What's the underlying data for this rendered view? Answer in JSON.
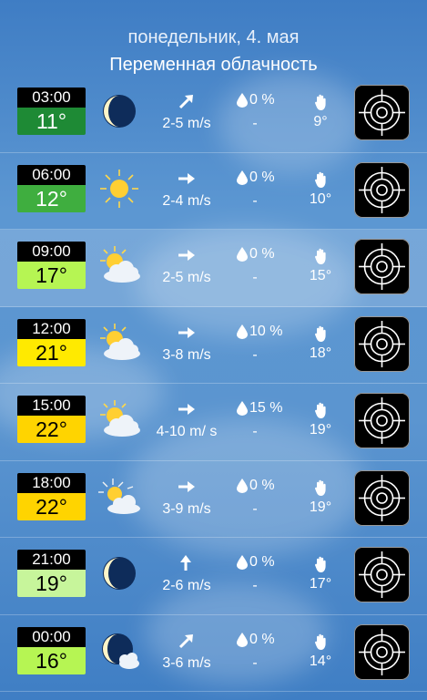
{
  "header": {
    "date": "понедельник, 4. мая",
    "condition": "Переменная облачность"
  },
  "colors": {
    "background": "#4f8ccb",
    "temp_green_dark": "#1e8a35",
    "temp_green": "#3fae3f",
    "temp_lime": "#b6f553",
    "temp_yellow": "#ffea00",
    "temp_yellow_orange": "#ffd400",
    "temp_light_green": "#c7f59b"
  },
  "rows": [
    {
      "time": "03:00",
      "temp": "11°",
      "temp_color": "#1e8a35",
      "temp_text": "#ffffff",
      "icon": "moon-icon",
      "wind_dir": "northeast-arrow-icon",
      "wind": "2-5 m/s",
      "precip_pct": "0 %",
      "precip_amt": "-",
      "uv": "9°",
      "highlight": false
    },
    {
      "time": "06:00",
      "temp": "12°",
      "temp_color": "#3fae3f",
      "temp_text": "#ffffff",
      "icon": "sun-icon",
      "wind_dir": "east-arrow-icon",
      "wind": "2-4 m/s",
      "precip_pct": "0 %",
      "precip_amt": "-",
      "uv": "10°",
      "highlight": false
    },
    {
      "time": "09:00",
      "temp": "17°",
      "temp_color": "#b6f553",
      "temp_text": "#000000",
      "icon": "sun-cloud-icon",
      "wind_dir": "east-arrow-icon",
      "wind": "2-5 m/s",
      "precip_pct": "0 %",
      "precip_amt": "-",
      "uv": "15°",
      "highlight": true
    },
    {
      "time": "12:00",
      "temp": "21°",
      "temp_color": "#ffea00",
      "temp_text": "#000000",
      "icon": "sun-cloud-icon",
      "wind_dir": "east-arrow-icon",
      "wind": "3-8 m/s",
      "precip_pct": "10 %",
      "precip_amt": "-",
      "uv": "18°",
      "highlight": false
    },
    {
      "time": "15:00",
      "temp": "22°",
      "temp_color": "#ffd400",
      "temp_text": "#000000",
      "icon": "sun-cloud-icon",
      "wind_dir": "east-arrow-icon",
      "wind": "4-10 m/ s",
      "precip_pct": "15 %",
      "precip_amt": "-",
      "uv": "19°",
      "highlight": false
    },
    {
      "time": "18:00",
      "temp": "22°",
      "temp_color": "#ffd400",
      "temp_text": "#000000",
      "icon": "sunset-cloud-icon",
      "wind_dir": "east-arrow-icon",
      "wind": "3-9 m/s",
      "precip_pct": "0 %",
      "precip_amt": "-",
      "uv": "19°",
      "highlight": false
    },
    {
      "time": "21:00",
      "temp": "19°",
      "temp_color": "#c7f59b",
      "temp_text": "#000000",
      "icon": "moon-icon",
      "wind_dir": "north-arrow-icon",
      "wind": "2-6 m/s",
      "precip_pct": "0 %",
      "precip_amt": "-",
      "uv": "17°",
      "highlight": false
    },
    {
      "time": "00:00",
      "temp": "16°",
      "temp_color": "#b6f553",
      "temp_text": "#000000",
      "icon": "moon-cloud-icon",
      "wind_dir": "northeast-arrow-icon",
      "wind": "3-6 m/s",
      "precip_pct": "0 %",
      "precip_amt": "-",
      "uv": "14°",
      "highlight": false
    }
  ]
}
